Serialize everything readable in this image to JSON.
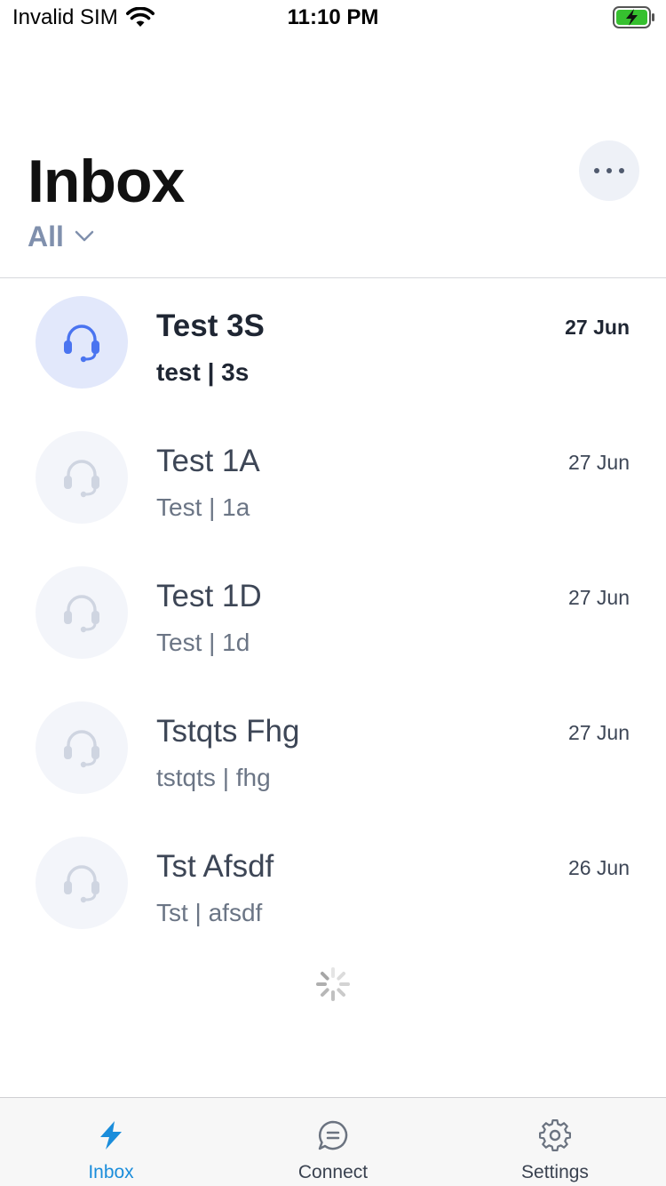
{
  "status_bar": {
    "carrier": "Invalid SIM",
    "time": "11:10 PM",
    "battery_color": "#36c02f"
  },
  "header": {
    "title": "Inbox",
    "filter_label": "All",
    "more_icon": "more-horizontal-icon"
  },
  "conversations": [
    {
      "name": "Test 3S",
      "preview": "test | 3s",
      "date": "27 Jun",
      "unread": true,
      "icon": "headset-icon"
    },
    {
      "name": "Test 1A",
      "preview": "Test | 1a",
      "date": "27 Jun",
      "unread": false,
      "icon": "headset-icon"
    },
    {
      "name": "Test 1D",
      "preview": "Test | 1d",
      "date": "27 Jun",
      "unread": false,
      "icon": "headset-icon"
    },
    {
      "name": "Tstqts Fhg",
      "preview": "tstqts | fhg",
      "date": "27 Jun",
      "unread": false,
      "icon": "headset-icon"
    },
    {
      "name": "Tst Afsdf",
      "preview": "Tst | afsdf",
      "date": "26 Jun",
      "unread": false,
      "icon": "headset-icon"
    }
  ],
  "tab_bar": {
    "tabs": [
      {
        "label": "Inbox",
        "icon": "lightning-icon",
        "active": true
      },
      {
        "label": "Connect",
        "icon": "chat-bubble-icon",
        "active": false
      },
      {
        "label": "Settings",
        "icon": "gear-icon",
        "active": false
      }
    ],
    "accent_color": "#1a8ddb"
  }
}
